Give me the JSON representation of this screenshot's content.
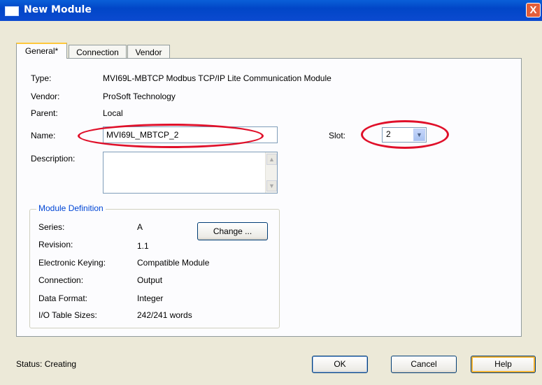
{
  "window": {
    "title": "New Module",
    "close_label": "X"
  },
  "tabs": [
    {
      "label": "General*"
    },
    {
      "label": "Connection"
    },
    {
      "label": "Vendor"
    }
  ],
  "general": {
    "type_label": "Type:",
    "type_value": "MVI69L-MBTCP Modbus TCP/IP Lite Communication Module",
    "vendor_label": "Vendor:",
    "vendor_value": "ProSoft Technology",
    "parent_label": "Parent:",
    "parent_value": "Local",
    "name_label": "Name:",
    "name_value": "MVI69L_MBTCP_2",
    "slot_label": "Slot:",
    "slot_value": "2",
    "description_label": "Description:",
    "description_value": ""
  },
  "module_definition": {
    "title": "Module Definition",
    "series_label": "Series:",
    "series_value": "A",
    "revision_label": "Revision:",
    "revision_value": "1.1",
    "keying_label": "Electronic Keying:",
    "keying_value": "Compatible Module",
    "connection_label": "Connection:",
    "connection_value": "Output",
    "format_label": "Data Format:",
    "format_value": "Integer",
    "io_label": "I/O Table Sizes:",
    "io_value": "242/241 words",
    "change_button": "Change ..."
  },
  "footer": {
    "status_text": "Status:  Creating",
    "ok_label": "OK",
    "cancel_label": "Cancel",
    "help_label": "Help"
  },
  "colors": {
    "titlebar": "#0146c7",
    "highlight_ellipse": "#e0102a",
    "group_title": "#0046d5"
  }
}
